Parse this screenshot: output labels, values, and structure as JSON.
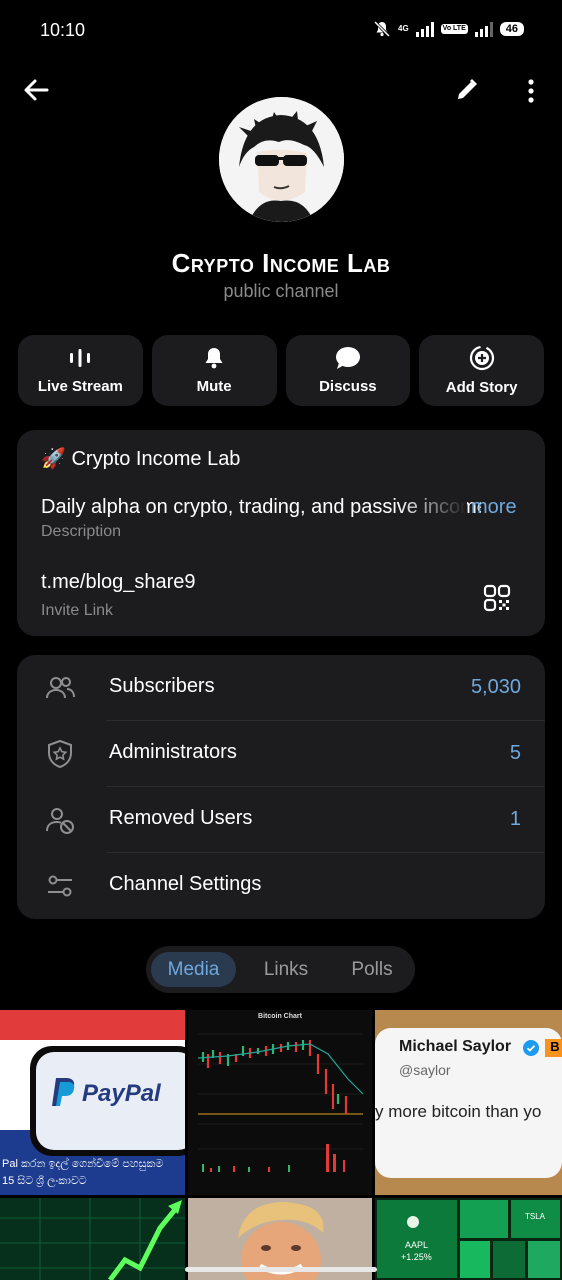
{
  "status": {
    "time": "10:10",
    "net1": "4G",
    "net2": "Vo LTE",
    "battery": "46"
  },
  "profile": {
    "title": "Crypto Income Lab",
    "subtitle": "public channel"
  },
  "actions": [
    {
      "label": "Live Stream",
      "icon": "live-stream-icon"
    },
    {
      "label": "Mute",
      "icon": "bell-icon"
    },
    {
      "label": "Discuss",
      "icon": "chat-bubble-icon"
    },
    {
      "label": "Add Story",
      "icon": "add-story-icon"
    }
  ],
  "info": {
    "name": "🚀 Crypto Income Lab",
    "description": "Daily alpha on crypto, trading, and passive income",
    "more": "more",
    "description_label": "Description",
    "link": "t.me/blog_share9",
    "link_label": "Invite Link"
  },
  "list": [
    {
      "label": "Subscribers",
      "value": "5,030"
    },
    {
      "label": "Administrators",
      "value": "5"
    },
    {
      "label": "Removed Users",
      "value": "1"
    },
    {
      "label": "Channel Settings",
      "value": ""
    }
  ],
  "tabs": [
    {
      "label": "Media",
      "active": true
    },
    {
      "label": "Links",
      "active": false
    },
    {
      "label": "Polls",
      "active": false
    }
  ],
  "media": {
    "paypal_logo": "PayPal",
    "paypal_caption_1": "Pal කරන ඉදල් ගෙන්වීමේ පහසුකම",
    "paypal_caption_2": "15 සිට ශ්‍රී ලංකාවට",
    "chart_title": "Bitcoin Chart",
    "saylor_name": "Michael Saylor",
    "saylor_handle": "@saylor",
    "saylor_badge": "B",
    "saylor_text": "y more bitcoin than yo",
    "stock_label": "AAPL",
    "stock_value": "+1.25%",
    "stock_label2": "TSLA"
  },
  "colors": {
    "accent": "#6fa8dc",
    "card": "#1c1c1e",
    "background": "#000000"
  }
}
